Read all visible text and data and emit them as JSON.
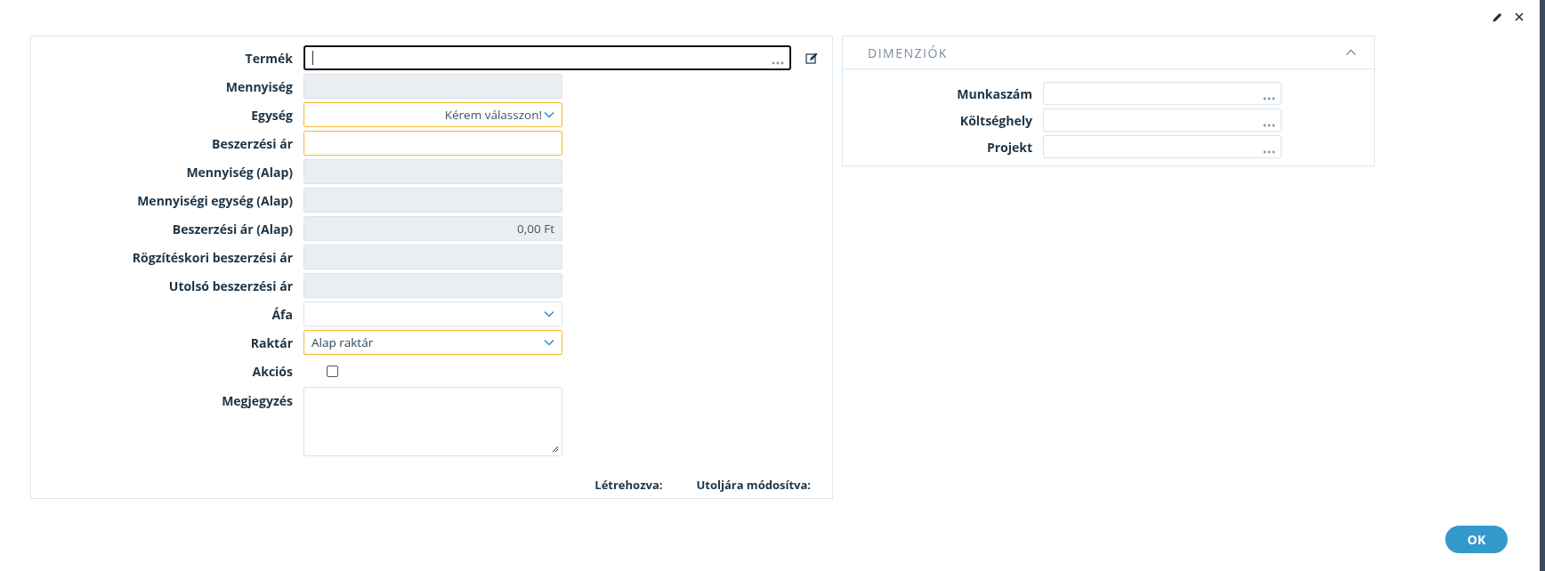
{
  "form": {
    "fields": [
      {
        "label": "Termék",
        "kind": "lookup",
        "required": false,
        "focused": true
      },
      {
        "label": "Mennyiség",
        "kind": "readonly",
        "required": false,
        "focused": false
      },
      {
        "label": "Egység",
        "kind": "select",
        "required": true,
        "focused": false,
        "placeholder": "Kérem válasszon!"
      },
      {
        "label": "Beszerzési ár",
        "kind": "text",
        "required": true,
        "focused": false
      },
      {
        "label": "Mennyiség (Alap)",
        "kind": "readonly",
        "required": false,
        "focused": false
      },
      {
        "label": "Mennyiségi egység (Alap)",
        "kind": "readonly",
        "required": false,
        "focused": false
      },
      {
        "label": "Beszerzési ár (Alap)",
        "kind": "readonly",
        "required": false,
        "focused": false,
        "value": "0,00 Ft"
      },
      {
        "label": "Rögzítéskori beszerzési ár",
        "kind": "readonly",
        "required": false,
        "focused": false
      },
      {
        "label": "Utolsó beszerzési ár",
        "kind": "readonly",
        "required": false,
        "focused": false
      },
      {
        "label": "Áfa",
        "kind": "select",
        "required": false,
        "focused": false
      },
      {
        "label": "Raktár",
        "kind": "select",
        "required": true,
        "focused": false,
        "value": "Alap raktár"
      },
      {
        "label": "Akciós",
        "kind": "checkbox",
        "checked": false
      },
      {
        "label": "Megjegyzés",
        "kind": "textarea",
        "required": false,
        "focused": false
      }
    ],
    "footer": [
      "Létrehozva:",
      "Utoljára módosítva:"
    ]
  },
  "dimensions": {
    "title": "DIMENZIÓK",
    "expanded": true,
    "fields": [
      {
        "label": "Munkaszám",
        "kind": "lookup"
      },
      {
        "label": "Költséghely",
        "kind": "lookup"
      },
      {
        "label": "Projekt",
        "kind": "lookup"
      }
    ]
  },
  "buttons": [
    "OK"
  ]
}
